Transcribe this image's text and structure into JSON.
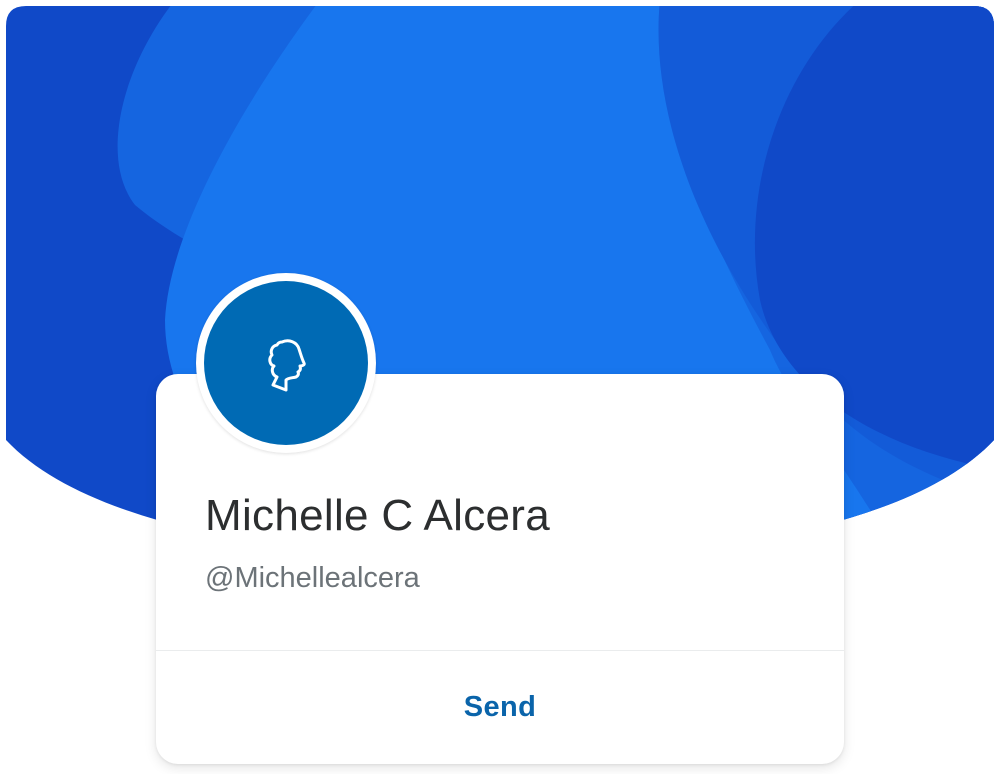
{
  "profile": {
    "name": "Michelle C Alcera",
    "handle": "@Michellealcera",
    "avatar_icon": "profile-head-icon"
  },
  "actions": {
    "send_label": "Send"
  },
  "colors": {
    "hero_dark": "#1049c8",
    "hero_mid": "#1565e0",
    "hero_light": "#1876ee",
    "avatar_bg": "#006ab4",
    "accent": "#0a64aa",
    "name_text": "#2c2e2f",
    "handle_text": "#6c7378"
  }
}
